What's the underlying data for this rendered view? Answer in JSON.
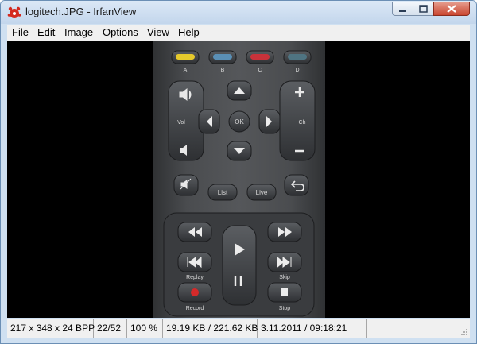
{
  "window": {
    "title": "logitech.JPG - IrfanView"
  },
  "menu": [
    "File",
    "Edit",
    "Image",
    "Options",
    "View",
    "Help"
  ],
  "remote": {
    "color_buttons": [
      {
        "label": "A",
        "color": "#e5c92c"
      },
      {
        "label": "B",
        "color": "#5a8fb5"
      },
      {
        "label": "C",
        "color": "#c8323a"
      },
      {
        "label": "D",
        "color": "#4f7482"
      }
    ],
    "vol_label": "Vol",
    "ch_label": "Ch",
    "ok_label": "OK",
    "list_label": "List",
    "live_label": "Live",
    "replay_label": "Replay",
    "skip_label": "Skip",
    "record_label": "Record",
    "stop_label": "Stop"
  },
  "status": {
    "dimensions": "217 x 348 x 24 BPP",
    "index": "22/52",
    "zoom": "100 %",
    "size": "19.19 KB / 221.62 KB",
    "datetime": "3.11.2011 / 09:18:21"
  }
}
